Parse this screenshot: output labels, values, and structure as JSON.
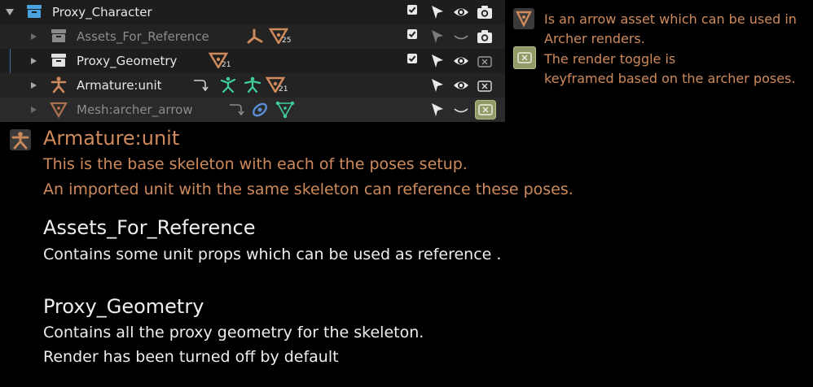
{
  "outliner": {
    "rows": [
      {
        "label": "Proxy_Character"
      },
      {
        "label": "Assets_For_Reference",
        "badge_count": "25"
      },
      {
        "label": "Proxy_Geometry",
        "badge_count": "21"
      },
      {
        "label": "Armature:unit",
        "badge_count": "21"
      },
      {
        "label": "Mesh:archer_arrow"
      }
    ]
  },
  "legend": {
    "arrow_asset_lines": [
      "Is an arrow asset which can be used in",
      "Archer renders."
    ],
    "render_toggle_lines": [
      "The render toggle is",
      "keyframed based on the archer poses."
    ]
  },
  "sections": [
    {
      "title": "Armature:unit",
      "lines": [
        "This is the base skeleton with each of the poses setup.",
        "An imported unit with the same skeleton can reference these poses."
      ]
    },
    {
      "title": "Assets_For_Reference",
      "lines": [
        "Contains some unit props which can be used as reference ."
      ]
    },
    {
      "title": "Proxy_Geometry",
      "lines": [
        "Contains all the proxy geometry for the skeleton.",
        "Render has been turned off by default"
      ]
    }
  ],
  "colors": {
    "accent_orange": "#cf8a5c",
    "collection_blue": "#4aa3e0",
    "render_toggle_green": "#8f9a66",
    "panel_bg": "#1d1d1d"
  }
}
